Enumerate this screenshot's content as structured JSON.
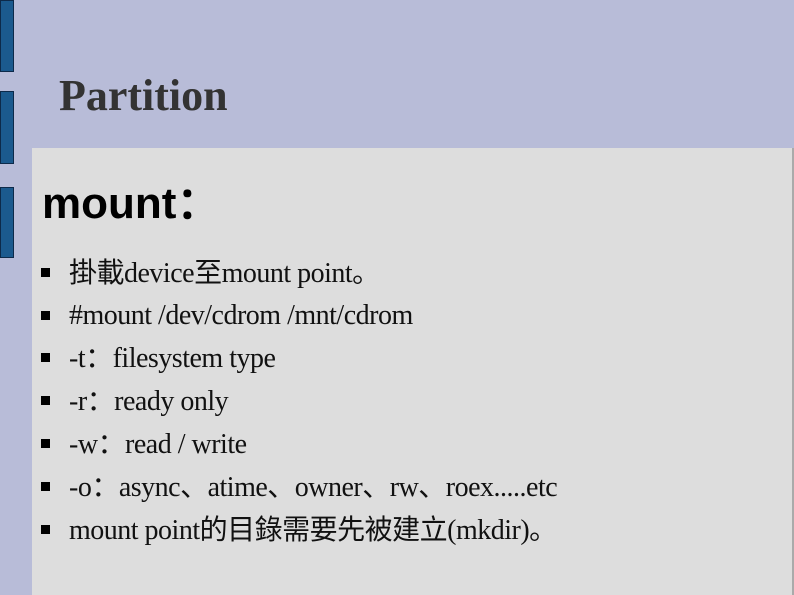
{
  "slide": {
    "title": "Partition",
    "heading": "mount：",
    "bullets": [
      {
        "text": "掛載device至mount point。"
      },
      {
        "text": "#mount /dev/cdrom /mnt/cdrom"
      },
      {
        "text": "-t：filesystem type"
      },
      {
        "text": "-r：ready only"
      },
      {
        "text": "-w：read / write"
      },
      {
        "text": "-o：async、atime、owner、rw、roex.....etc"
      },
      {
        "text": "mount point的目錄需要先被建立(mkdir)。"
      }
    ]
  },
  "colors": {
    "background": "#b8bcd8",
    "accent_bar": "#1b5a8e",
    "panel": "#dddddd",
    "title_text": "#333333"
  }
}
